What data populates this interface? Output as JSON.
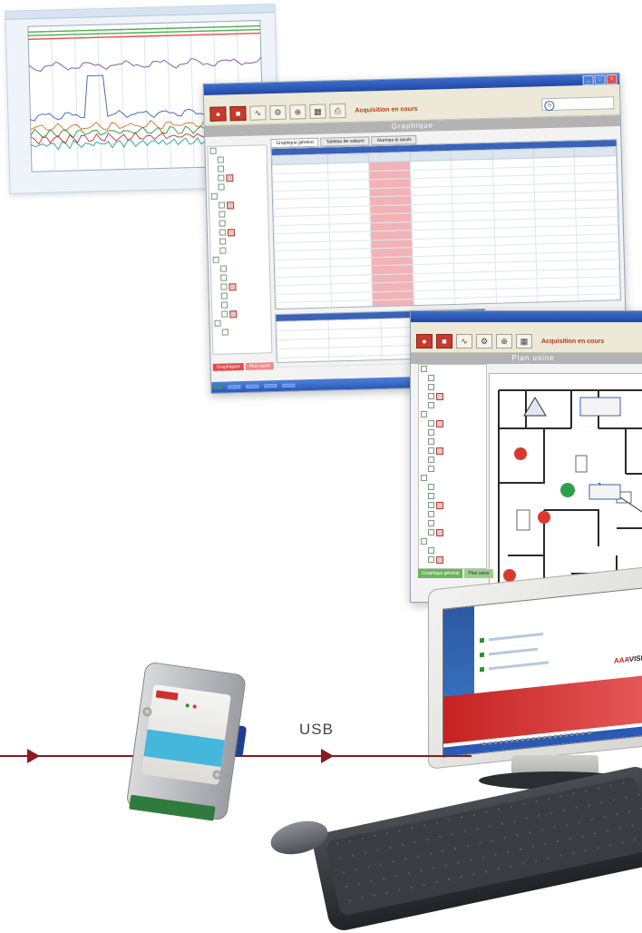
{
  "colors": {
    "wire": "#8b1a1f",
    "device_accent": "#45b7dc",
    "highlight_cell": "#f2b3b6",
    "window_title": "#2148a8"
  },
  "connection": {
    "label": "USB"
  },
  "data_window": {
    "title": "",
    "menu": [
      "",
      "",
      "",
      "",
      ""
    ],
    "toolbar": {
      "status": "Acquisition en cours",
      "clock": ""
    },
    "section_title": "Graphique",
    "tabs": [
      "Graphique général",
      "Tableau de valeurs",
      "Alarmes et seuils"
    ],
    "tree_items": [
      "",
      "",
      "",
      "",
      "",
      "",
      "",
      "",
      "",
      "",
      "",
      "",
      "",
      "",
      "",
      "",
      "",
      "",
      "",
      "",
      ""
    ],
    "grid": {
      "caption": "",
      "columns": [
        "",
        "",
        "",
        "",
        "",
        "",
        "",
        ""
      ],
      "rows": [
        [
          "",
          "",
          "",
          "",
          "",
          "",
          "",
          ""
        ],
        [
          "",
          "",
          "",
          "",
          "",
          "",
          "",
          ""
        ],
        [
          "",
          "",
          "",
          "",
          "",
          "",
          "",
          ""
        ],
        [
          "",
          "",
          "",
          "",
          "",
          "",
          "",
          ""
        ],
        [
          "",
          "",
          "",
          "",
          "",
          "",
          "",
          ""
        ],
        [
          "",
          "",
          "",
          "",
          "",
          "",
          "",
          ""
        ],
        [
          "",
          "",
          "",
          "",
          "",
          "",
          "",
          ""
        ],
        [
          "",
          "",
          "",
          "",
          "",
          "",
          "",
          ""
        ],
        [
          "",
          "",
          "",
          "",
          "",
          "",
          "",
          ""
        ],
        [
          "",
          "",
          "",
          "",
          "",
          "",
          "",
          ""
        ],
        [
          "",
          "",
          "",
          "",
          "",
          "",
          "",
          ""
        ],
        [
          "",
          "",
          "",
          "",
          "",
          "",
          "",
          ""
        ],
        [
          "",
          "",
          "",
          "",
          "",
          "",
          "",
          ""
        ],
        [
          "",
          "",
          "",
          "",
          "",
          "",
          "",
          ""
        ],
        [
          "",
          "",
          "",
          "",
          "",
          "",
          "",
          ""
        ],
        [
          "",
          "",
          "",
          "",
          "",
          "",
          "",
          ""
        ],
        [
          "",
          "",
          "",
          "",
          "",
          "",
          "",
          ""
        ],
        [
          "",
          "",
          "",
          "",
          "",
          "",
          "",
          ""
        ],
        [
          "",
          "",
          "",
          "",
          "",
          "",
          "",
          ""
        ],
        [
          "",
          "",
          "",
          "",
          "",
          "",
          "",
          ""
        ],
        [
          "",
          "",
          "",
          "",
          "",
          "",
          "",
          ""
        ],
        [
          "",
          "",
          "",
          "",
          "",
          "",
          "",
          ""
        ],
        [
          "",
          "",
          "",
          "",
          "",
          "",
          "",
          ""
        ]
      ],
      "highlight_column": 2
    },
    "stats_caption": "",
    "bottom_tabs": [
      "Graphiques",
      "Plan usine"
    ],
    "taskbar": [
      "",
      "",
      "",
      ""
    ]
  },
  "plan_window": {
    "title": "",
    "menu": [
      "",
      "",
      "",
      "",
      ""
    ],
    "toolbar_status": "Acquisition en cours",
    "section_title": "Plan usine",
    "tree_items": [
      "",
      "",
      "",
      "",
      "",
      "",
      "",
      "",
      "",
      "",
      "",
      "",
      "",
      "",
      "",
      "",
      "",
      "",
      "",
      "",
      "",
      ""
    ],
    "readouts": [
      "",
      ""
    ],
    "bottom_tabs": [
      "Graphique général",
      "Plan usine"
    ]
  },
  "chart_window": {
    "series_colors": [
      "#8a5ca8",
      "#4c6fb8",
      "#e07a3a",
      "#3d9a4a",
      "#c54545",
      "#3aa7a0"
    ]
  },
  "screen": {
    "logo_prefix": "AAA",
    "logo_main": "VISION"
  }
}
